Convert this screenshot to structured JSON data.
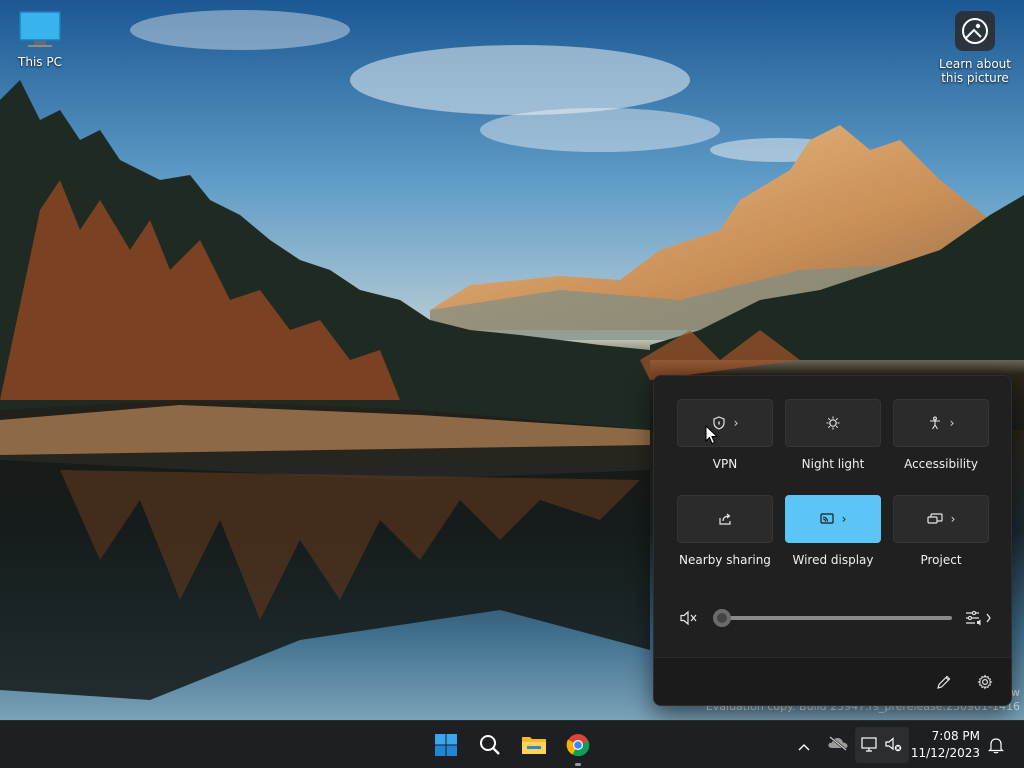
{
  "desktop": {
    "this_pc_label": "This PC",
    "learn_label_line1": "Learn about",
    "learn_label_line2": "this picture"
  },
  "watermark": {
    "line1": "w",
    "line2": "Evaluation copy. Build 25947.rs_prerelease.230901-1416"
  },
  "quick_settings": {
    "tiles": [
      {
        "label": "VPN",
        "icon": "shield-icon",
        "has_chevron": true,
        "active": false
      },
      {
        "label": "Night light",
        "icon": "brightness-icon",
        "has_chevron": false,
        "active": false
      },
      {
        "label": "Accessibility",
        "icon": "accessibility-icon",
        "has_chevron": true,
        "active": false
      },
      {
        "label": "Nearby sharing",
        "icon": "share-icon",
        "has_chevron": false,
        "active": false
      },
      {
        "label": "Wired display",
        "icon": "cast-icon",
        "has_chevron": true,
        "active": true
      },
      {
        "label": "Project",
        "icon": "project-icon",
        "has_chevron": true,
        "active": false
      }
    ],
    "volume": {
      "level": 0,
      "muted": true
    },
    "accent_color": "#5bc6f5"
  },
  "taskbar": {
    "pinned": [
      "start-icon",
      "search-icon",
      "file-explorer-icon",
      "chrome-icon"
    ],
    "clock_time": "7:08 PM",
    "clock_date": "11/12/2023"
  }
}
